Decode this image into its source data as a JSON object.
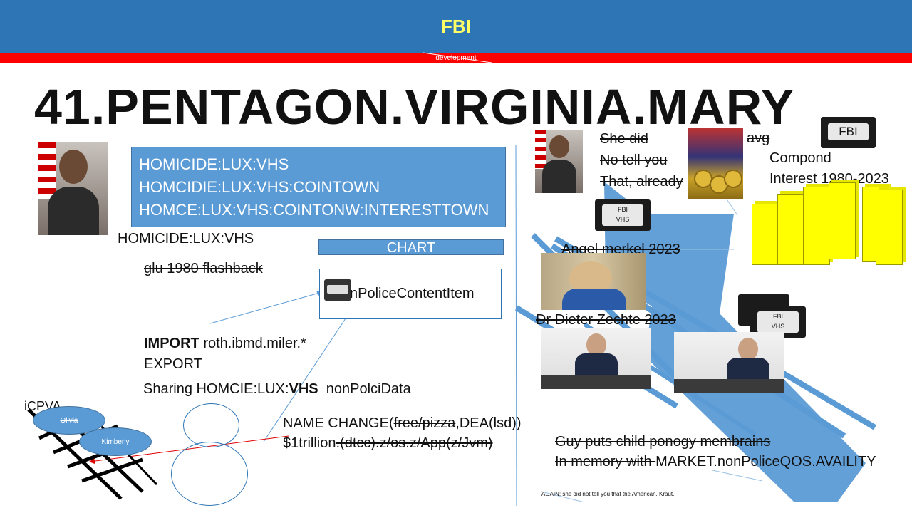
{
  "header": {
    "title": "FBI",
    "subtitle": "development"
  },
  "main_title": "41.PENTAGON.VIRGINIA.MARY",
  "homicide_box": {
    "lines": [
      "HOMICIDE:LUX:VHS",
      "HOMCIDIE:LUX:VHS:COINTOWN",
      "HOMCE:LUX:VHS:COINTONW:INTERESTTOWN"
    ]
  },
  "caption_homicide": "HOMICIDE:LUX:VHS",
  "chart_label": "CHART",
  "flashback_text": "glu 1980 flashback",
  "content_item": "nPoliceContentItem",
  "import_keyword": "IMPORT",
  "import_path": "roth.ibmd.miler.*",
  "export_text": "EXPORT",
  "sharing": {
    "prefix": "Sharing HOMCIE:LUX:",
    "bold": "VHS",
    "suffix": "nonPolciData"
  },
  "icpva_label": "iCPVA",
  "ellipse_olivia": "Olivia",
  "ellipse_kimberly": "Kimberly",
  "name_change": {
    "prefix": "NAME CHANGE(",
    "struck": "free/pizza",
    "suffix": ",DEA(lsd))"
  },
  "trillion": {
    "prefix": "$1trillion",
    "struck": ".(dtcc).z/os.z/App(z/Jvm)"
  },
  "she_did_lines": [
    "She did",
    "No tell you",
    "That, already"
  ],
  "avg_label": "avg",
  "vhs_label_big": "FBI",
  "vhs_label_small": [
    "FBI",
    "VHS"
  ],
  "compound_lines": [
    "Compond",
    "Interest 1980-2023"
  ],
  "angel_caption": "Angel merkel 2023",
  "dieter_caption": "Dr Dieter Zechte 2023",
  "guy_line": "Guy puts child ponogy membrains",
  "memory_line": {
    "struck": "In memory with ",
    "normal": "MARKET.nonPoliceQOS.AVAILITY"
  },
  "again_line": {
    "prefix": "AGAIN: ",
    "struck": "she did not tell you that the American. Kraut."
  },
  "colors": {
    "header_blue": "#2e75b6",
    "accent_red": "#ff0000",
    "box_blue": "#5b9bd5",
    "bar_yellow": "#ffff00"
  },
  "bars_shown": 6
}
